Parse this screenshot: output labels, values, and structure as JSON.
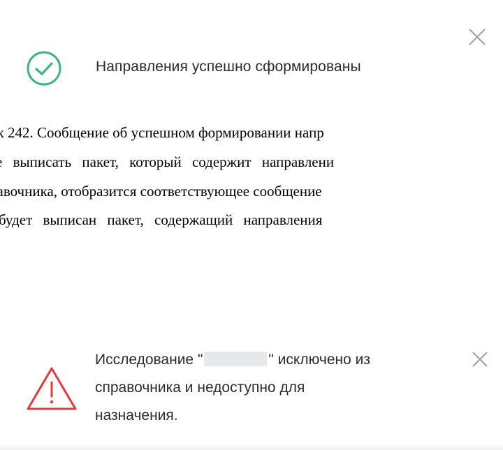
{
  "success_toast": {
    "message": "Направления успешно сформированы",
    "colors": {
      "icon": "#3db483",
      "close": "#9aa0a6"
    },
    "icons": {
      "status": "check-circle-icon",
      "close": "close-icon"
    }
  },
  "document": {
    "lines": [
      "ок 242. Сообщение об успешном формировании напр",
      "е выписать пакет, который содержит направлени",
      "равочника, отобразится соответствующее сообщение",
      "будет выписан пакет, содержащий направления"
    ]
  },
  "warning_toast": {
    "message_prefix": "Исследование \"",
    "message_suffix": "\" исключено из",
    "message_line2": "справочника и недоступно для",
    "message_line3": "назначения.",
    "colors": {
      "icon": "#e3393f",
      "close": "#9aa0a6"
    },
    "icons": {
      "status": "warning-triangle-icon",
      "close": "close-icon"
    }
  }
}
